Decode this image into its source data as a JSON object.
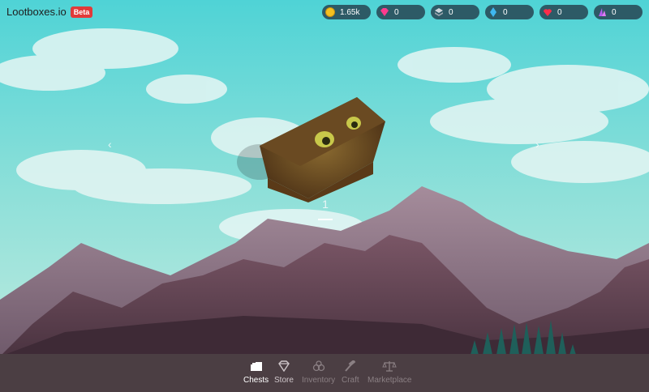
{
  "app": {
    "title": "Lootboxes.io",
    "badge": "Beta"
  },
  "currencies": [
    {
      "icon": "coin-icon",
      "value": "1.65k"
    },
    {
      "icon": "gem-icon",
      "value": "0"
    },
    {
      "icon": "stack-icon",
      "value": "0"
    },
    {
      "icon": "crystal-icon",
      "value": "0"
    },
    {
      "icon": "heart-icon",
      "value": "0"
    },
    {
      "icon": "shard-icon",
      "value": "0"
    }
  ],
  "carousel": {
    "count": "1",
    "prev_icon": "chevron-left-icon",
    "next_icon": "chevron-right-icon"
  },
  "nav": [
    {
      "label": "Chests",
      "icon": "chests-icon",
      "active": true
    },
    {
      "label": "Store",
      "icon": "diamond-icon",
      "active": false
    },
    {
      "label": "Inventory",
      "icon": "inventory-icon",
      "active": false
    },
    {
      "label": "Craft",
      "icon": "hammer-icon",
      "active": false
    },
    {
      "label": "Marketplace",
      "icon": "scales-icon",
      "active": false
    }
  ],
  "colors": {
    "sky": "#6fd0cf",
    "nav_bg": "#4b3e43",
    "pill_bg": "#2d5a66",
    "beta": "#e23a3a"
  }
}
